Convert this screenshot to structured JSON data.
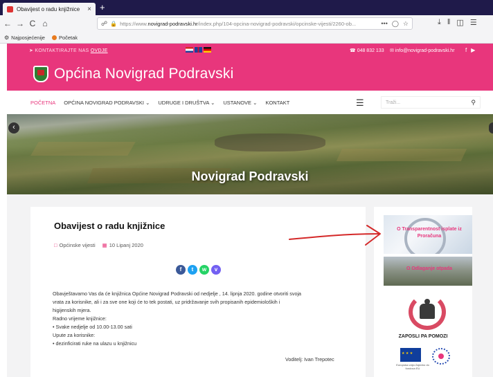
{
  "browser": {
    "tab_title": "Obavijest o radu knjižnice",
    "tab_close": "×",
    "new_tab": "+",
    "url_prefix": "https://www.",
    "url_domain": "novigrad-podravski.hr",
    "url_rest": "/index.php/104-opcina-novigrad-podravski/opcinske-vijesti/2260-ob...",
    "url_more": "•••",
    "bookmarks": [
      "Najposjećenije",
      "Početak"
    ],
    "nav": {
      "back": "←",
      "forward": "→",
      "reload": "C",
      "home": "⌂"
    }
  },
  "topbar": {
    "contact_prefix": "KONTAKTIRAJTE NAS",
    "contact_link": "OVDJE",
    "phone": "048 832 133",
    "email": "info@novigrad-podravski.hr"
  },
  "site": {
    "name": "Općina Novigrad Podravski"
  },
  "menu": {
    "items": [
      {
        "label": "POČETNA"
      },
      {
        "label": "OPĆINA NOVIGRAD PODRAVSKI ⌄"
      },
      {
        "label": "UDRUGE I DRUŠTVA ⌄"
      },
      {
        "label": "USTANOVE ⌄"
      },
      {
        "label": "KONTAKT"
      }
    ],
    "search_placeholder": "Traži..."
  },
  "banner": {
    "title": "Novigrad Podravski"
  },
  "article": {
    "title": "Obavijest o radu knjižnice",
    "category": "Općinske vijesti",
    "date": "10 Lipanj 2020",
    "body": [
      "Obavještavamo Vas da će knjižnica Općine Novigrad Podravski od nedjelje , 14. lipnja 2020. godine otvoriti svoja",
      "vrata za korisnike, ali i za sve one koji će to tek postati, uz pridržavanje svih propisanih epidemioloških i",
      "higijenskih mjera.",
      "Radno vrijeme knjižnice:",
      "• Svake nedjelje od 10.00-13.00 sati",
      "Upute za korisnike:",
      "• dezinficirati ruke na ulazu u knjižnicu"
    ],
    "signature": "Voditelj: Ivan Trepotec"
  },
  "sidebar": {
    "transparency": "O Transparentnost isplate iz Proračuna",
    "waste": "O Odlaganje otpada",
    "zaposli": "ZAPOSLI PA POMOZI",
    "eu_caption": "Europska unija Zajedno do fondova EU"
  },
  "colors": {
    "brand": "#e8367c",
    "tabbar": "#1f1a4a",
    "arrow": "#d42828"
  }
}
